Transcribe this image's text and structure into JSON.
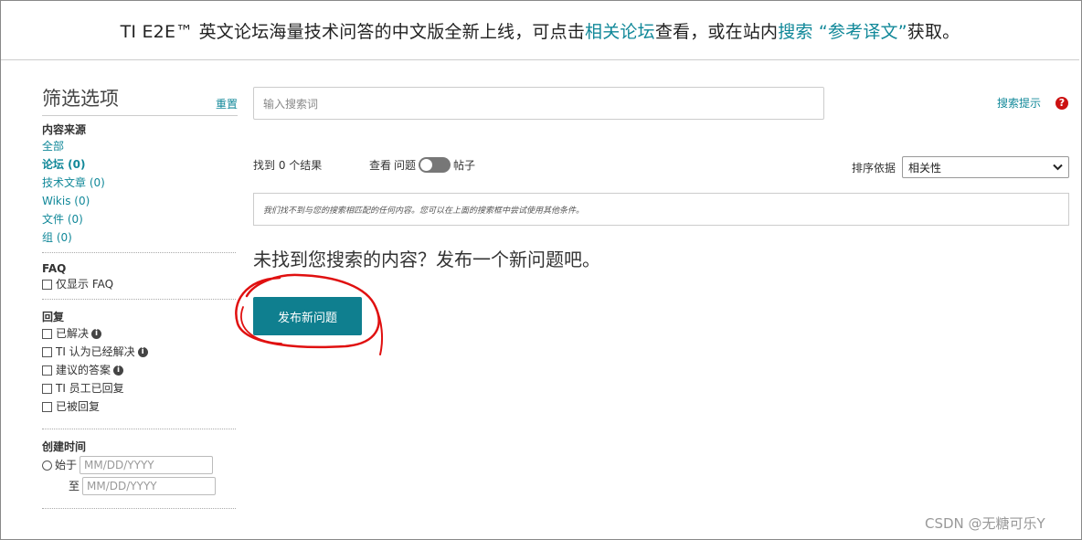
{
  "banner": {
    "pre": "TI E2E™ 英文论坛海量技术问答的中文版全新上线，可点击",
    "link1": "相关论坛",
    "mid": "查看，或在站内",
    "link2": "搜索 “参考译文”",
    "post": " 获取。"
  },
  "sidebar": {
    "title": "筛选选项",
    "reset": "重置",
    "content_source": {
      "title": "内容来源",
      "items": [
        {
          "label": "全部"
        },
        {
          "label": "论坛 (0)"
        },
        {
          "label": "技术文章 (0)"
        },
        {
          "label": "Wikis (0)"
        },
        {
          "label": "文件 (0)"
        },
        {
          "label": "组 (0)"
        }
      ]
    },
    "faq": {
      "title": "FAQ",
      "option": "仅显示 FAQ"
    },
    "reply": {
      "title": "回复",
      "options": [
        "已解决",
        "TI 认为已经解决",
        "建议的答案",
        "TI 员工已回复",
        "已被回复"
      ]
    },
    "created": {
      "title": "创建时间",
      "from_label": "始于",
      "to_label": "至",
      "placeholder": "MM/DD/YYYY"
    }
  },
  "search": {
    "placeholder": "输入搜索词",
    "tips": "搜索提示"
  },
  "results": {
    "count_text": "找到 0 个结果",
    "view_label": "查看",
    "view_option_left": "问题",
    "view_option_right": "帖子",
    "sort_label": "排序依据",
    "sort_value": "相关性",
    "notice": "我们找不到与您的搜索相匹配的任何内容。您可以在上面的搜索框中尝试使用其他条件。",
    "empty_title": "未找到您搜索的内容？发布一个新问题吧。",
    "post_button": "发布新问题"
  },
  "watermark": "CSDN @无糖可乐Y",
  "colors": {
    "accent": "#118899",
    "button": "#0f7f8f",
    "annotation": "#e01010",
    "help": "#cc1111"
  },
  "icons": [
    "info-icon",
    "help-icon",
    "chevron-down-icon"
  ]
}
